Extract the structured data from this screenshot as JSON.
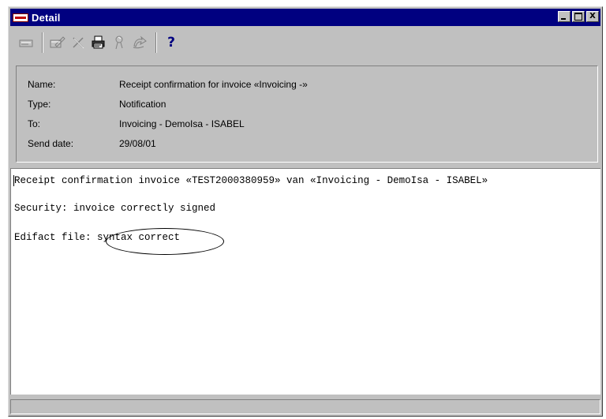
{
  "window": {
    "title": "Detail",
    "app_icon": "isabel-app-icon",
    "controls": {
      "minimize": "minimize-icon",
      "maximize": "maximize-icon",
      "close_label": "X"
    }
  },
  "toolbar": {
    "items": [
      {
        "icon": "document-icon",
        "enabled": false
      },
      {
        "icon": "sign-icon",
        "enabled": false
      },
      {
        "icon": "delete-icon",
        "enabled": false
      },
      {
        "icon": "print-icon",
        "enabled": true
      },
      {
        "icon": "stamp-icon",
        "enabled": false
      },
      {
        "icon": "forward-icon",
        "enabled": false
      },
      {
        "icon": "help-icon",
        "enabled": true,
        "label": "?"
      }
    ]
  },
  "info": {
    "name_label": "Name:",
    "name_value": "Receipt confirmation for invoice «Invoicing -»",
    "type_label": "Type:",
    "type_value": "Notification",
    "to_label": "To:",
    "to_value": "Invoicing - DemoIsa - ISABEL",
    "date_label": "Send date:",
    "date_value": "29/08/01"
  },
  "message": {
    "line1": "Receipt confirmation invoice «TEST2000380959» van «Invoicing - DemoIsa - ISABEL»",
    "line2": "Security: invoice correctly signed",
    "line3_prefix": "Edifact file:",
    "line3_value": " syntax correct"
  },
  "status_bar": {
    "text": ""
  },
  "colors": {
    "titlebar": "#000080",
    "face": "#c0c0c0",
    "help": "#000080"
  }
}
